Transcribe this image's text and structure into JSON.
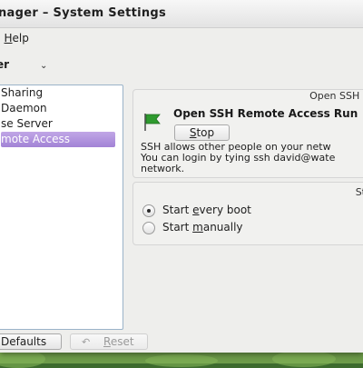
{
  "window": {
    "title": "nager – System Settings"
  },
  "menu": {
    "help_prefix": ")",
    "help_underlined": "H",
    "help_rest": "elp"
  },
  "module_heading": "er",
  "services": [
    {
      "label": "Sharing",
      "selected": false
    },
    {
      "label": "Daemon",
      "selected": false
    },
    {
      "label": "se Server",
      "selected": false
    },
    {
      "label": "mote Access",
      "selected": true
    }
  ],
  "details": {
    "group_title": "Open SSH I",
    "service_name": "Open SSH Remote Access Run",
    "stop_button": {
      "underlined": "S",
      "rest": "top"
    },
    "description": [
      "SSH allows other people on your netw",
      "You can login by tying ssh david@wate",
      "network."
    ]
  },
  "startup": {
    "title": "St",
    "options": [
      {
        "prefix": "Start ",
        "underlined": "e",
        "rest": "very boot",
        "checked": true
      },
      {
        "prefix": "Start ",
        "underlined": "m",
        "rest": "anually",
        "checked": false
      }
    ]
  },
  "footer": {
    "defaults_label": "Defaults",
    "reset_button": {
      "underlined": "R",
      "rest": "eset",
      "enabled": false
    }
  },
  "colors": {
    "selection": "#a283d6",
    "flag": "#2e9a2e"
  },
  "icons": [
    "help-icon",
    "flag-icon",
    "reset-icon"
  ]
}
